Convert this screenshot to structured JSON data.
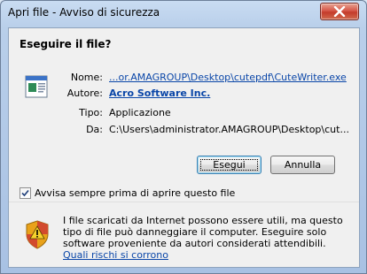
{
  "window": {
    "title": "Apri file - Avviso di sicurezza"
  },
  "dialog": {
    "heading": "Eseguire il file?",
    "fields": {
      "name_label": "Nome:",
      "name_value": "...or.AMAGROUP\\Desktop\\cutepdf\\CuteWriter.exe",
      "publisher_label": "Autore:",
      "publisher_value": "Acro Software Inc.",
      "type_label": "Tipo:",
      "type_value": "Applicazione",
      "from_label": "Da:",
      "from_value": "C:\\Users\\administrator.AMAGROUP\\Desktop\\cut..."
    },
    "buttons": {
      "run": "Esegui",
      "cancel": "Annulla"
    },
    "checkbox": {
      "label": "Avvisa sempre prima di aprire questo file",
      "checked": true
    },
    "footer": {
      "text": "I file scaricati da Internet possono essere utili, ma questo tipo di file può danneggiare il computer. Eseguire solo software proveniente da autori considerati attendibili.",
      "link": "Quali rischi si corrono"
    }
  },
  "icons": {
    "close": "close-icon",
    "file": "executable-file-icon",
    "shield": "security-shield-warning-icon",
    "check": "checkmark-icon"
  },
  "colors": {
    "link": "#0a46a8",
    "close_button": "#c43b2a",
    "title_bar": "#b9cfea"
  }
}
